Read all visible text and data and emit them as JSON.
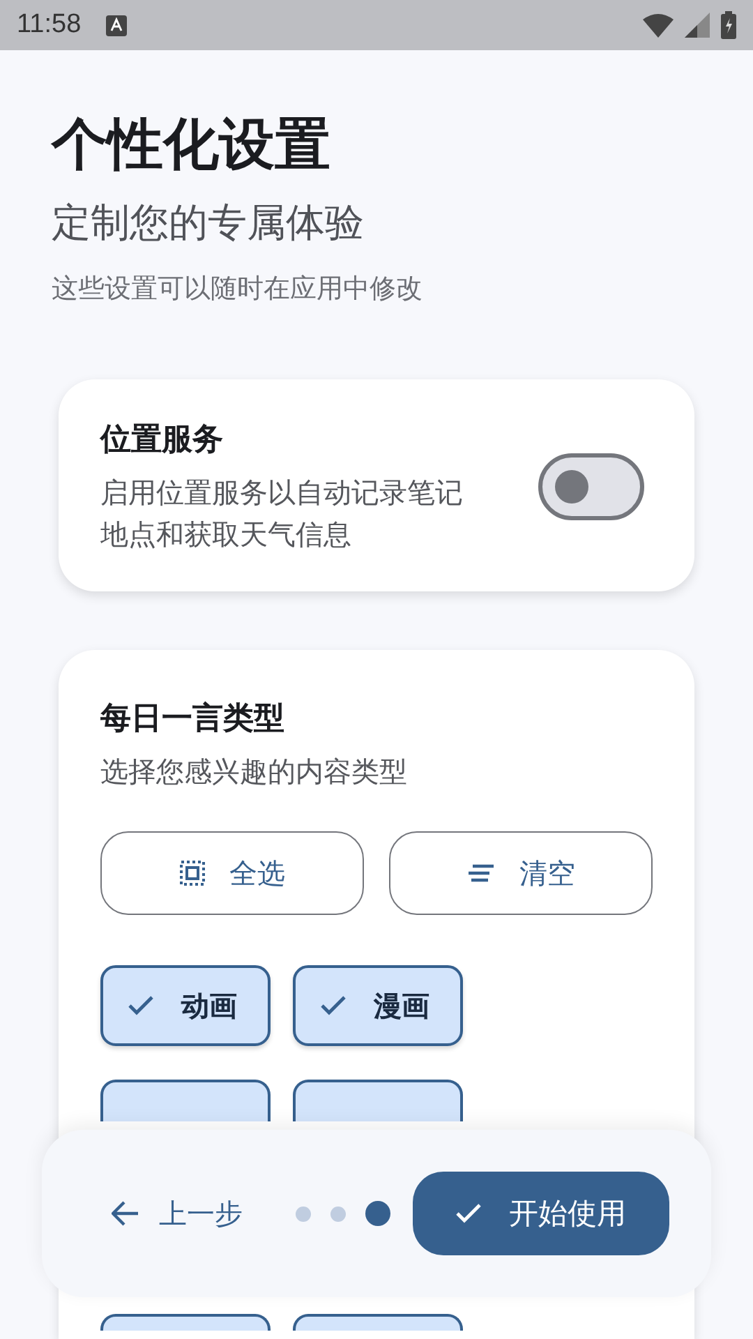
{
  "status_bar": {
    "time": "11:58"
  },
  "header": {
    "title": "个性化设置",
    "subtitle": "定制您的专属体验",
    "hint": "这些设置可以随时在应用中修改"
  },
  "location_card": {
    "title": "位置服务",
    "description": "启用位置服务以自动记录笔记地点和获取天气信息",
    "on": false
  },
  "quote_card": {
    "title": "每日一言类型",
    "description": "选择您感兴趣的内容类型",
    "actions": [
      {
        "kind": "select_all",
        "label": "全选"
      },
      {
        "kind": "clear",
        "label": "清空"
      }
    ],
    "chip_rows": [
      [
        {
          "label": "动画",
          "selected": true
        },
        {
          "label": "漫画",
          "selected": true
        }
      ],
      [
        {
          "selected": true
        },
        {
          "selected": true
        }
      ],
      [
        {
          "selected": true
        },
        {
          "selected": true
        }
      ]
    ]
  },
  "footer": {
    "back": "上一步",
    "steps": [
      {
        "selected": false
      },
      {
        "selected": false
      },
      {
        "selected": true
      }
    ],
    "primary": "开始使用"
  }
}
